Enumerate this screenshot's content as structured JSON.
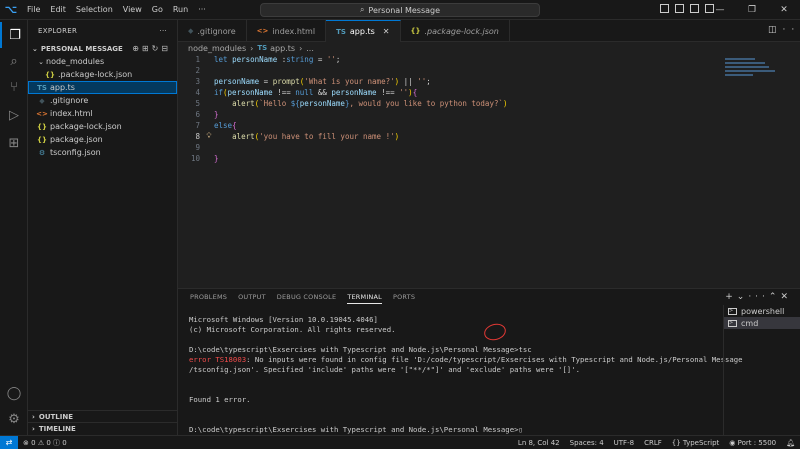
{
  "menu": [
    "File",
    "Edit",
    "Selection",
    "View",
    "Go",
    "Run"
  ],
  "menu_more": "···",
  "search": {
    "label": "Personal Message"
  },
  "explorer": {
    "title": "EXPLORER",
    "more": "···",
    "workspace": "PERSONAL MESSAGE",
    "tree": [
      {
        "label": "node_modules",
        "kind": "folder",
        "indent": 1,
        "icon": "chevron-down"
      },
      {
        "label": ".package-lock.json",
        "kind": "json",
        "indent": 2,
        "icon": "{}"
      },
      {
        "label": "app.ts",
        "kind": "ts",
        "indent": 1,
        "icon": "TS",
        "selected": true
      },
      {
        "label": ".gitignore",
        "kind": "git",
        "indent": 1,
        "icon": "◆"
      },
      {
        "label": "index.html",
        "kind": "html",
        "indent": 1,
        "icon": "<>"
      },
      {
        "label": "package-lock.json",
        "kind": "json",
        "indent": 1,
        "icon": "{}"
      },
      {
        "label": "package.json",
        "kind": "json",
        "indent": 1,
        "icon": "{}"
      },
      {
        "label": "tsconfig.json",
        "kind": "ts",
        "indent": 1,
        "icon": "⚙"
      }
    ],
    "outline": "OUTLINE",
    "timeline": "TIMELINE"
  },
  "tabs": [
    {
      "label": ".gitignore",
      "icon": "◆",
      "kind": "git",
      "active": false,
      "italic": false
    },
    {
      "label": "index.html",
      "icon": "<>",
      "kind": "html",
      "active": false,
      "italic": false
    },
    {
      "label": "app.ts",
      "icon": "TS",
      "kind": "ts",
      "active": true,
      "italic": false,
      "close": "✕"
    },
    {
      "label": ".package-lock.json",
      "icon": "{}",
      "kind": "json",
      "active": false,
      "italic": true
    }
  ],
  "breadcrumb": {
    "folder": "node_modules",
    "file": "app.ts",
    "icon": "TS",
    "tail": "..."
  },
  "code": [
    {
      "n": "1",
      "tokens": [
        [
          "kw",
          "let "
        ],
        [
          "var",
          "personName "
        ],
        [
          "op",
          ":"
        ],
        [
          "kw",
          "string"
        ],
        [
          "op",
          " = "
        ],
        [
          "str",
          "''"
        ],
        [
          "op",
          ";"
        ]
      ]
    },
    {
      "n": "2",
      "tokens": []
    },
    {
      "n": "3",
      "tokens": [
        [
          "var",
          "personName"
        ],
        [
          "op",
          " = "
        ],
        [
          "fn",
          "prompt"
        ],
        [
          "brk",
          "("
        ],
        [
          "str",
          "'What is your name?'"
        ],
        [
          "brk",
          ")"
        ],
        [
          "op",
          " || "
        ],
        [
          "str",
          "''"
        ],
        [
          "op",
          ";"
        ]
      ]
    },
    {
      "n": "4",
      "tokens": [
        [
          "kw",
          "if"
        ],
        [
          "brk",
          "("
        ],
        [
          "var",
          "personName"
        ],
        [
          "op",
          " !== "
        ],
        [
          "kw",
          "null"
        ],
        [
          "op",
          " && "
        ],
        [
          "var",
          "personName"
        ],
        [
          "op",
          " !== "
        ],
        [
          "str",
          "''"
        ],
        [
          "brk",
          ")"
        ],
        [
          "brk2",
          "{"
        ]
      ]
    },
    {
      "n": "5",
      "tokens": [
        [
          "op",
          "    "
        ],
        [
          "fn",
          "alert"
        ],
        [
          "brk",
          "("
        ],
        [
          "str",
          "`Hello "
        ],
        [
          "tmpl",
          "${"
        ],
        [
          "var",
          "personName"
        ],
        [
          "tmpl",
          "}"
        ],
        [
          "str",
          ", would you like to python today?`"
        ],
        [
          "brk",
          ")"
        ]
      ]
    },
    {
      "n": "6",
      "tokens": [
        [
          "brk2",
          "}"
        ]
      ]
    },
    {
      "n": "7",
      "tokens": [
        [
          "kw",
          "else"
        ],
        [
          "brk2",
          "{"
        ]
      ]
    },
    {
      "n": "8",
      "tokens": [
        [
          "op",
          "    "
        ],
        [
          "fn",
          "alert"
        ],
        [
          "brk",
          "("
        ],
        [
          "str",
          "'you have to fill your name !'"
        ],
        [
          "brk",
          ")"
        ]
      ],
      "current": true,
      "bulb": true
    },
    {
      "n": "9",
      "tokens": []
    },
    {
      "n": "10",
      "tokens": [
        [
          "brk2",
          "}"
        ]
      ]
    }
  ],
  "panel": {
    "tabs": [
      "PROBLEMS",
      "OUTPUT",
      "DEBUG CONSOLE",
      "TERMINAL",
      "PORTS"
    ],
    "active_tab": "TERMINAL",
    "terminal_lines": [
      {
        "text": "Microsoft Windows [Version 10.0.19045.4046]"
      },
      {
        "text": "(c) Microsoft Corporation. All rights reserved."
      },
      {
        "text": ""
      },
      {
        "text": "D:\\code\\typescript\\Exsercises with Typescript and Node.js\\Personal Message>tsc"
      },
      {
        "err": "error",
        "code": " TS18003",
        "rest": ": No inputs were found in config file 'D:/code/typescript/Exsercises with Typescript and Node.js/Personal Message"
      },
      {
        "text": "/tsconfig.json'. Specified 'include' paths were '[\"**/*\"]' and 'exclude' paths were '[]'."
      },
      {
        "text": ""
      },
      {
        "text": ""
      },
      {
        "text": "Found 1 error."
      },
      {
        "text": ""
      },
      {
        "text": ""
      },
      {
        "text": "D:\\code\\typescript\\Exsercises with Typescript and Node.js\\Personal Message>▯"
      }
    ],
    "terminals": [
      {
        "label": "powershell",
        "active": false
      },
      {
        "label": "cmd",
        "active": true
      }
    ]
  },
  "status": {
    "errors": "0",
    "warnings": "0",
    "info": "0",
    "position": "Ln 8, Col 42",
    "spaces": "Spaces: 4",
    "encoding": "UTF-8",
    "eol": "CRLF",
    "language": "{} TypeScript",
    "port": "Port : 5500"
  }
}
